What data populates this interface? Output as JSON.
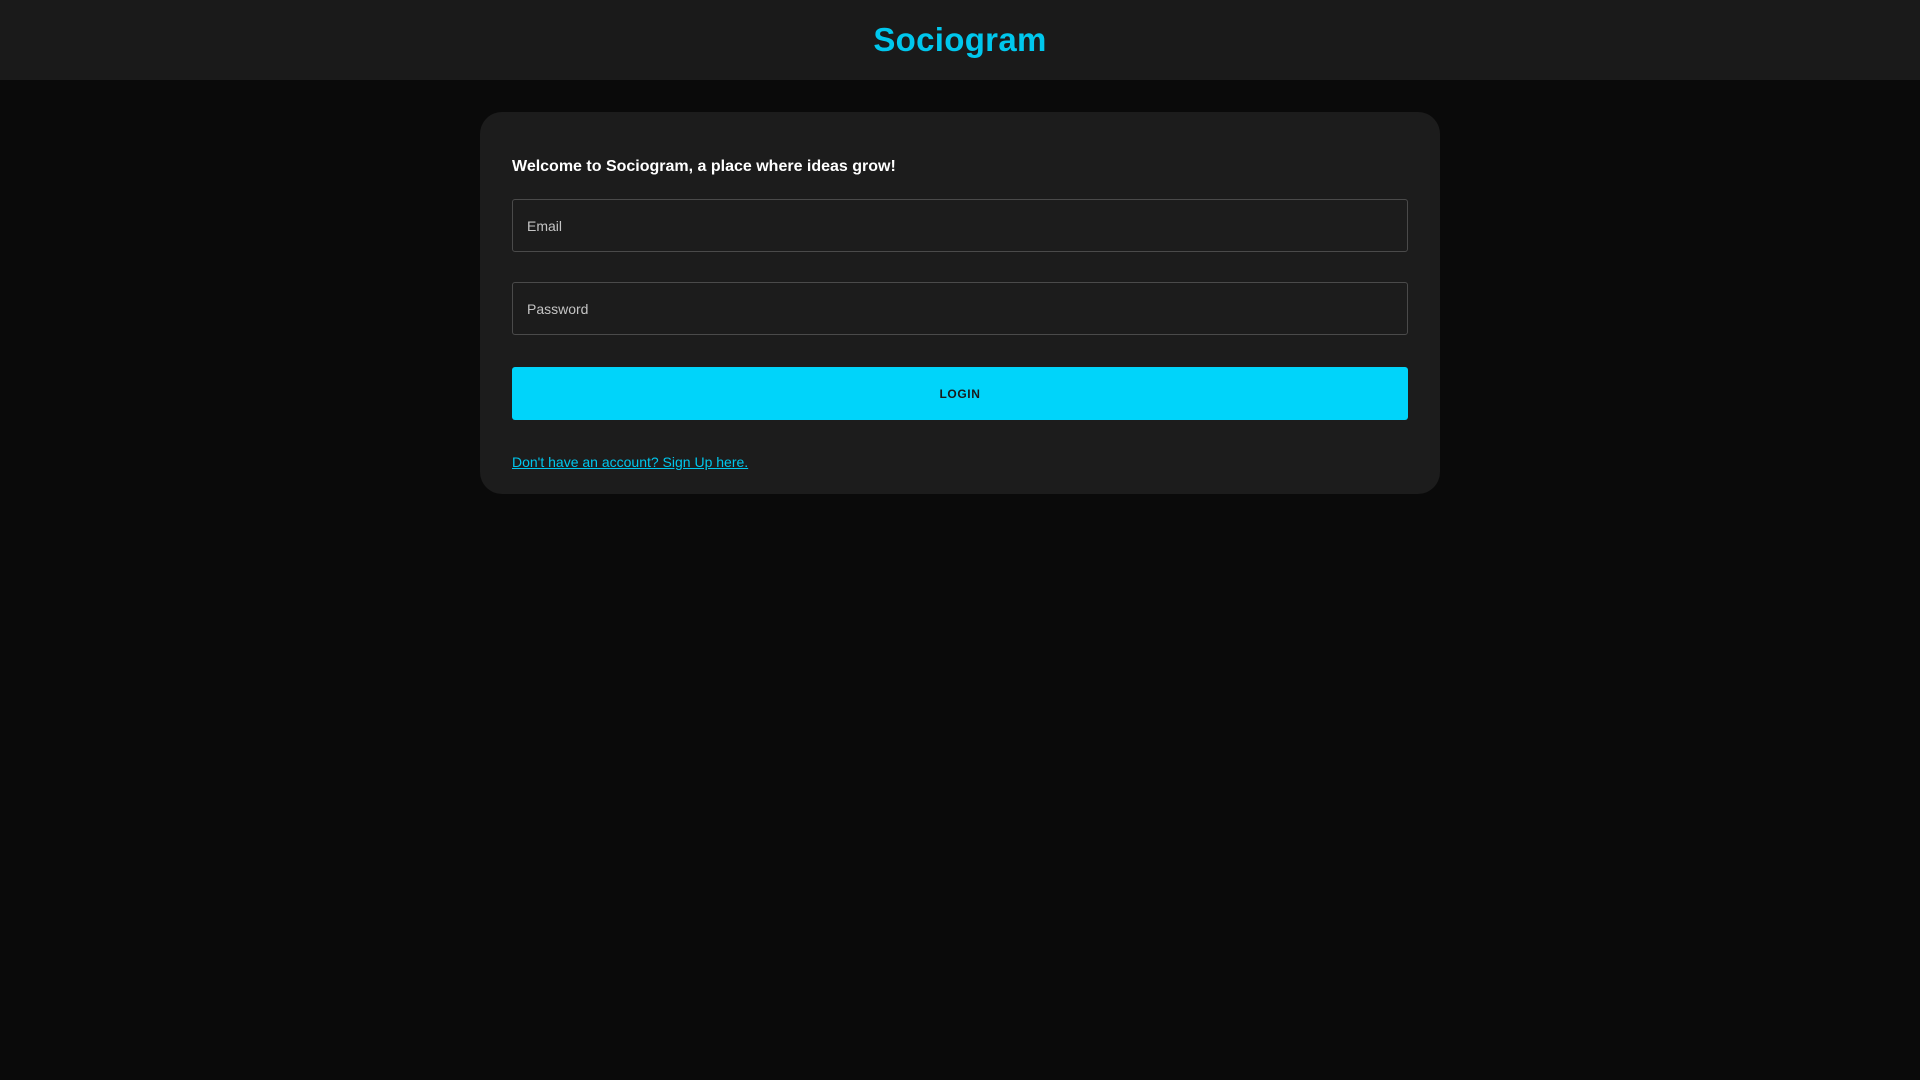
{
  "header": {
    "brand": "Sociogram"
  },
  "login_card": {
    "welcome_text": "Welcome to Sociogram, a place where ideas grow!",
    "email": {
      "placeholder": "Email",
      "value": ""
    },
    "password": {
      "placeholder": "Password",
      "value": ""
    },
    "login_label": "LOGIN",
    "signup_link": "Don't have an account? Sign Up here."
  },
  "colors": {
    "accent": "#00d4fa",
    "background": "#0a0a0a",
    "surface": "#1c1c1c",
    "topbar": "#1a1a1a"
  }
}
